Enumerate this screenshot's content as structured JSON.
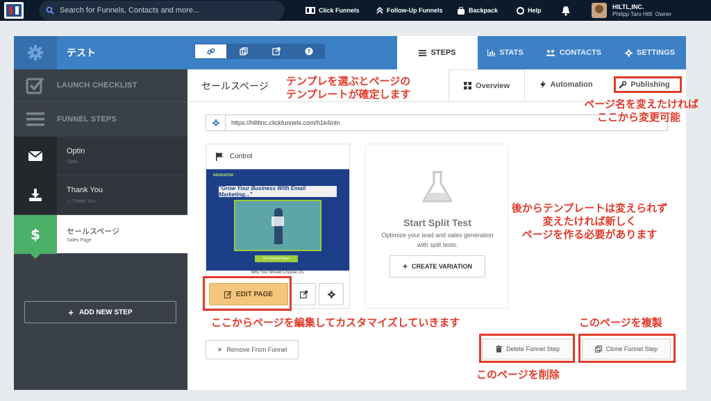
{
  "topbar": {
    "search_placeholder": "Search for Funnels, Contacts and more...",
    "links": [
      "Click Funnels",
      "Follow-Up Funnels",
      "Backpack",
      "Help"
    ],
    "user_company": "HILTL,INC.",
    "user_name": "Philipp Taro Hiltl",
    "user_role": "Owner"
  },
  "funnel": {
    "title": "テスト",
    "tabs": [
      "STEPS",
      "STATS",
      "CONTACTS",
      "SETTINGS"
    ],
    "active_tab": "STEPS"
  },
  "sidebar": {
    "launch_checklist": "LAUNCH CHECKLIST",
    "funnel_steps": "FUNNEL STEPS",
    "steps": [
      {
        "title": "Optin",
        "subtitle": "Optin"
      },
      {
        "title": "Thank You",
        "subtitle": "Thank You"
      },
      {
        "title": "セールスページ",
        "subtitle": "Sales Page"
      }
    ],
    "add_step": "ADD NEW STEP"
  },
  "page": {
    "title": "セールスページ",
    "tabs": [
      "Overview",
      "Automation",
      "Publishing"
    ],
    "url": "https://hiltlinc.clickfunnels.com/h1k4inln",
    "control_label": "Control",
    "thumb_nav": "NAVIGATOR",
    "thumb_headline": "\"Grow Your Business With Email Marketing...\"",
    "thumb_cta": "Get Started Now!",
    "thumb_why": "Why You Should Choose Us:",
    "edit_page": "EDIT PAGE",
    "split_title": "Start Split Test",
    "split_desc": "Optimize your lead and sales generation with split tests.",
    "create_variation": "CREATE VARIATION",
    "remove_from_funnel": "Remove From Funnel",
    "delete_step": "Delete Funnel Step",
    "clone_step": "Clone Funnel Step"
  },
  "annotations": {
    "template_note": [
      "テンプレを選ぶとページの",
      "テンプレートが確定します"
    ],
    "rename_note": [
      "ページ名を変えたければ",
      "ここから変更可能"
    ],
    "template_locked_note": [
      "後からテンプレートは変えられず",
      "変えたければ新しく",
      "ページを作る必要があります"
    ],
    "edit_note": "ここからページを編集してカスタマイズしていきます",
    "clone_note": "このページを複製",
    "delete_note": "このページを削除"
  },
  "colors": {
    "accent": "#3c80c6",
    "sidebar": "#3a4047",
    "active_step": "#4caf68",
    "annotation": "#e03a2a",
    "edit_button": "#f4c57c"
  }
}
